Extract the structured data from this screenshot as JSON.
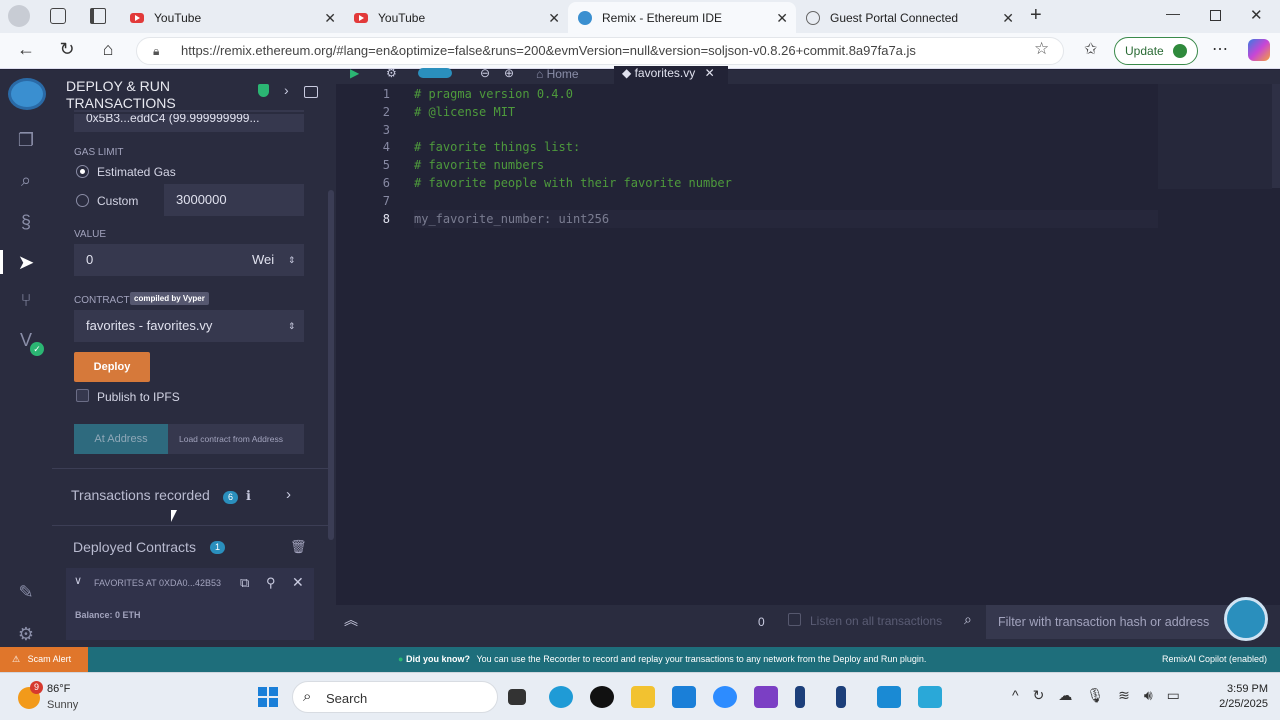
{
  "browser": {
    "tabs": [
      {
        "title": "YouTube"
      },
      {
        "title": "YouTube"
      },
      {
        "title": "Remix - Ethereum IDE"
      },
      {
        "title": "Guest Portal Connected"
      }
    ],
    "url": "https://remix.ethereum.org/#lang=en&optimize=false&runs=200&evmVersion=null&version=soljson-v0.8.26+commit.8a97fa7a.js",
    "update_label": "Update"
  },
  "panel": {
    "title_line1": "DEPLOY & RUN",
    "title_line2": "TRANSACTIONS",
    "account_value": "0x5B3...eddC4 (99.999999999...",
    "gas_limit_label": "GAS LIMIT",
    "estimated_gas_label": "Estimated Gas",
    "custom_label": "Custom",
    "custom_gas_value": "3000000",
    "value_label": "VALUE",
    "value_amount": "0",
    "value_unit": "Wei",
    "contract_label": "CONTRACT",
    "compiled_badge": "compiled by Vyper",
    "contract_selected": "favorites - favorites.vy",
    "deploy_label": "Deploy",
    "publish_ipfs_label": "Publish to IPFS",
    "at_address_label": "At Address",
    "load_contract_placeholder": "Load contract from Address",
    "transactions_recorded_label": "Transactions recorded",
    "transactions_count": "6",
    "deployed_contracts_label": "Deployed Contracts",
    "deployed_count": "1",
    "deployed_item": "FAVORITES AT 0XDA0...42B53",
    "balance_label": "Balance: 0 ETH"
  },
  "editor": {
    "home_tab": "Home",
    "file_tab": "favorites.vy",
    "lines": [
      {
        "num": "1",
        "text": "# pragma version 0.4.0",
        "kind": "comment"
      },
      {
        "num": "2",
        "text": "# @license MIT",
        "kind": "comment"
      },
      {
        "num": "3",
        "text": "",
        "kind": "plain"
      },
      {
        "num": "4",
        "text": "# favorite things list:",
        "kind": "comment"
      },
      {
        "num": "5",
        "text": "# favorite numbers",
        "kind": "comment"
      },
      {
        "num": "6",
        "text": "# favorite people with their favorite number",
        "kind": "comment"
      },
      {
        "num": "7",
        "text": "",
        "kind": "plain"
      },
      {
        "num": "8",
        "text": "my_favorite_number: uint256",
        "kind": "plain"
      }
    ]
  },
  "terminal": {
    "count": "0",
    "listen_label": "Listen on all transactions",
    "filter_placeholder": "Filter with transaction hash or address"
  },
  "statusbar": {
    "scam_alert": "Scam Alert",
    "did_you_know": "Did you know?",
    "tip": "You can use the Recorder to record and replay your transactions to any network from the Deploy and Run plugin.",
    "copilot": "RemixAI Copilot (enabled)"
  },
  "taskbar": {
    "weather_temp": "86°F",
    "weather_desc": "Sunny",
    "weather_badge": "9",
    "search_label": "Search",
    "time": "3:59 PM",
    "date": "2/25/2025"
  }
}
